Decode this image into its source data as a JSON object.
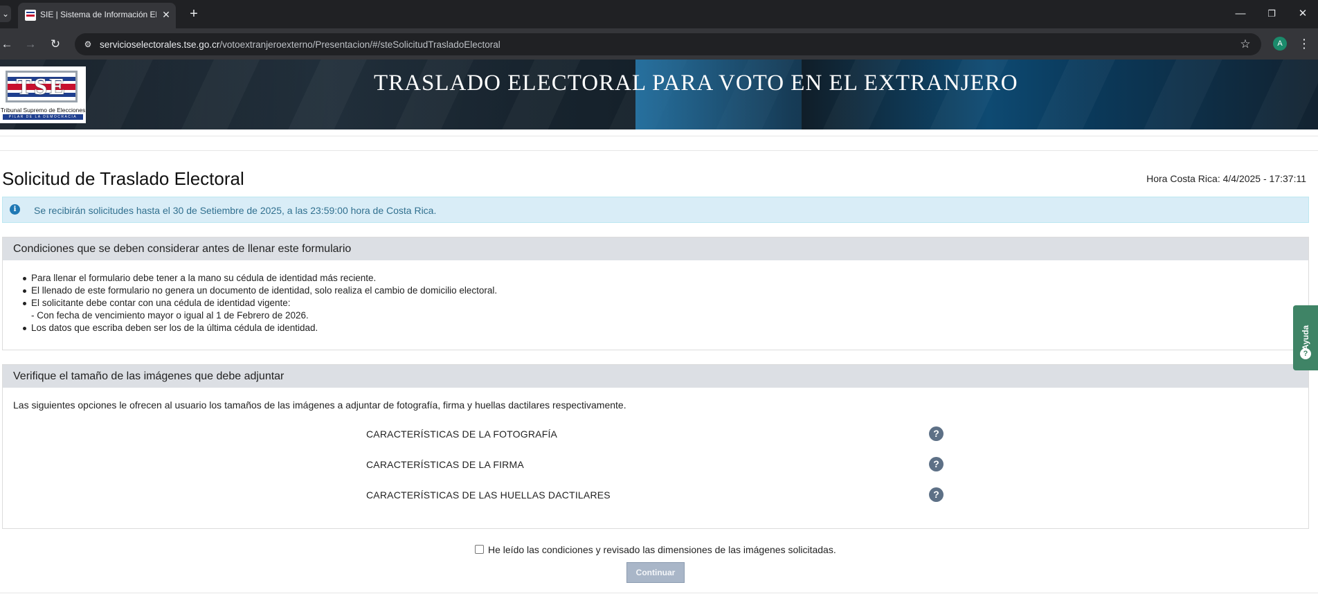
{
  "browser": {
    "tab_title": "SIE | Sistema de Información Electoral",
    "tab_close": "✕",
    "new_tab": "+",
    "url_host": "servicioselectorales.tse.go.cr",
    "url_path": "/votoextranjeroexterno/Presentacion/#/steSolicitudTrasladoElectoral",
    "profile_initial": "A",
    "icons": {
      "tab_list": "chevron-down-icon",
      "back": "arrow-left-icon",
      "forward": "arrow-right-icon",
      "reload": "reload-icon",
      "site_info": "site-info-icon",
      "bookmark": "star-icon",
      "menu": "kebab-menu-icon",
      "minimize": "minimize-icon",
      "restore": "restore-icon",
      "close": "close-icon"
    }
  },
  "header": {
    "banner_title": "TRASLADO ELECTORAL PARA VOTO EN EL EXTRANJERO",
    "logo_letters": "TSE",
    "logo_name": "Tribunal Supremo de Elecciones",
    "logo_motto": "PILAR DE LA DEMOCRACIA"
  },
  "page": {
    "title": "Solicitud de Traslado Electoral",
    "clock_label": "Hora Costa Rica: ",
    "clock_value": "4/4/2025 - 17:37:11"
  },
  "alert": {
    "text": "Se recibirán solicitudes hasta el 30 de Setiembre de 2025, a las 23:59:00 hora de Costa Rica."
  },
  "conditions": {
    "heading": "Condiciones que se deben considerar antes de llenar este formulario",
    "items": [
      "Para llenar el formulario debe tener a la mano su cédula de identidad más reciente.",
      "El llenado de este formulario no genera un documento de identidad, solo realiza el cambio de domicilio electoral.",
      "El solicitante debe contar con una cédula de identidad vigente:",
      "- Con fecha de vencimiento mayor o igual al 1 de Febrero de 2026.",
      "Los datos que escriba deben ser los de la última cédula de identidad."
    ]
  },
  "images": {
    "heading": "Verifique el tamaño de las imágenes que debe adjuntar",
    "description": "Las siguientes opciones le ofrecen al usuario los tamaños de las imágenes a adjuntar de fotografía, firma y huellas dactilares respectivamente.",
    "rows": [
      "CARACTERÍSTICAS DE LA FOTOGRAFÍA",
      "CARACTERÍSTICAS DE LA FIRMA",
      "CARACTERÍSTICAS DE LAS HUELLAS DACTILARES"
    ]
  },
  "form": {
    "ack_label": "He leído las condiciones y revisado las dimensiones de las imágenes solicitadas.",
    "continue_label": "Continuar",
    "ack_checked": false
  },
  "help_tab": {
    "label": "Ayuda"
  },
  "colors": {
    "alert_bg": "#d9edf7",
    "alert_text": "#31708f",
    "panel_header": "#dcdfe4",
    "help_tab": "#3f8466",
    "button_disabled": "#a9b6c8"
  }
}
